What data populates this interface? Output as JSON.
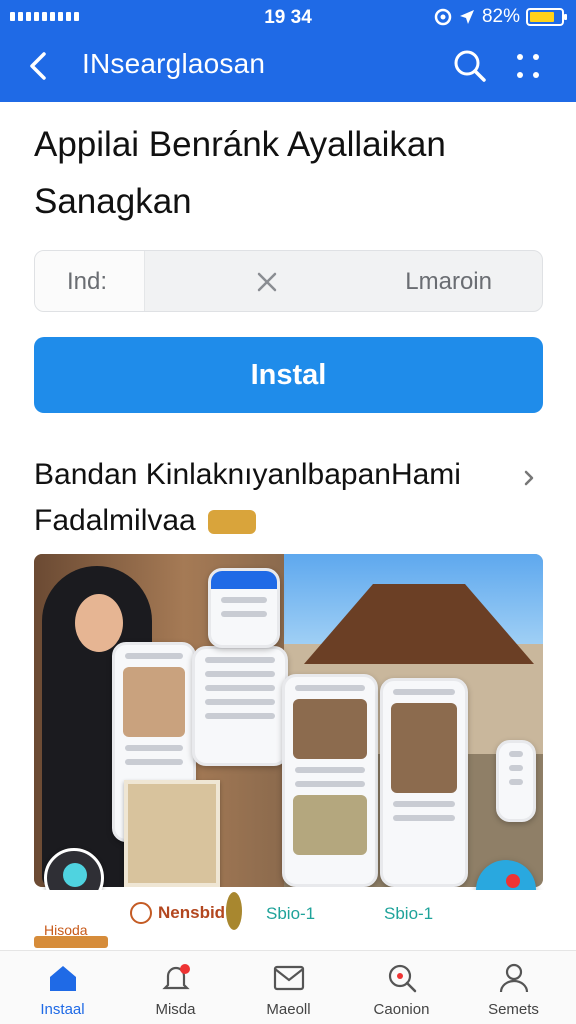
{
  "status_bar": {
    "time": "19 34",
    "battery": "82%"
  },
  "app_bar": {
    "title": "INsearglaosan"
  },
  "page_title": "Appilai Benránk Ayallaikan Sanagkan",
  "segmented": {
    "left": "Ind:",
    "right": "Lmaroin"
  },
  "install_button": "Instal",
  "section_title": "Bandan KinlaknıyanlbapanHami Fadalmilvaa",
  "chips": [
    "Hisoda",
    "Nensbid",
    "Sbio-1",
    "Sbio-1"
  ],
  "bottom_nav": [
    {
      "label": "Instaal",
      "icon": "home-icon",
      "active": true
    },
    {
      "label": "Misda",
      "icon": "bell-icon",
      "active": false
    },
    {
      "label": "Maeoll",
      "icon": "mail-icon",
      "active": false
    },
    {
      "label": "Caonion",
      "icon": "search-icon",
      "active": false
    },
    {
      "label": "Semets",
      "icon": "profile-icon",
      "active": false
    }
  ],
  "colors": {
    "primary": "#1f6ae6",
    "button": "#1f8cea",
    "fab": "#29a8df"
  }
}
